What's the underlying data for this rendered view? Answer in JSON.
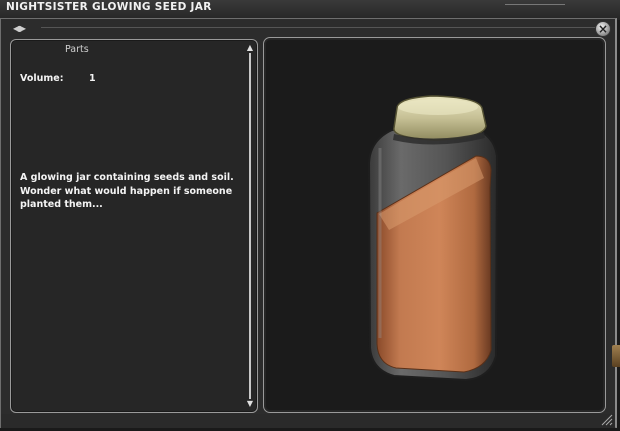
{
  "window": {
    "title": "NIGHTSISTER GLOWING SEED JAR",
    "close_glyph": "×",
    "nav_glyph": "◂●▸"
  },
  "info": {
    "parts_label": "Parts",
    "volume_label": "Volume:",
    "volume_value": "1",
    "description": "A glowing jar containing seeds and soil. Wonder what would happen if someone planted them..."
  },
  "scrollbar": {
    "up_glyph": "▲",
    "down_glyph": "▼"
  },
  "preview": {
    "jar_colors": {
      "lid": "#c8c39a",
      "glass": "#4a4a4a",
      "soil": "#c87a4e"
    }
  },
  "icons": [
    "close-icon",
    "nav-arrows-icon",
    "scroll-up-icon",
    "scroll-down-icon",
    "resize-grip-icon"
  ]
}
